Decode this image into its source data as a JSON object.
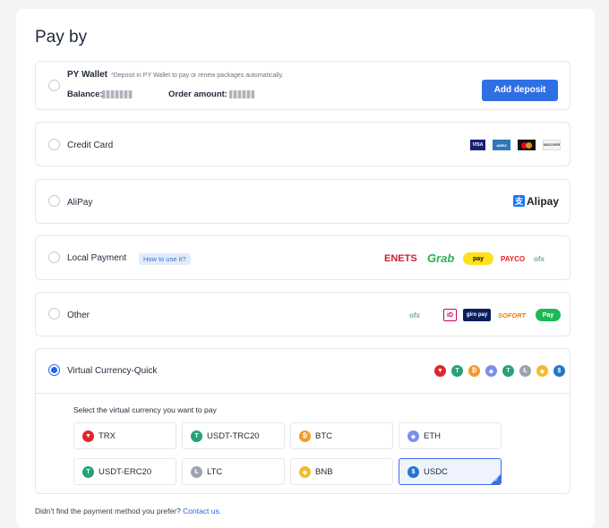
{
  "page": {
    "title": "Pay by"
  },
  "colors": {
    "accent": "#2f6fe4",
    "selected": "#2563eb"
  },
  "wallet": {
    "label": "PY Wallet",
    "note": "*Deposit in PY Wallet to pay or renew packages automatically.",
    "balance_label": "Balance:",
    "order_amount_label": "Order amount:",
    "add_deposit": "Add deposit"
  },
  "options": {
    "credit_card": {
      "label": "Credit Card",
      "logos": [
        "VISA",
        "AMEX",
        "mastercard",
        "DISCOVER"
      ]
    },
    "alipay": {
      "label": "AliPay",
      "logo_text": "Alipay"
    },
    "local": {
      "label": "Local Payment",
      "help": "How to use it?",
      "logos": [
        "ENETS",
        "Grab",
        "pay",
        "PAYCO",
        "ofx"
      ]
    },
    "other": {
      "label": "Other",
      "logos": [
        "ofx",
        "iD",
        "giro pay",
        "SOFORT",
        "Pay"
      ]
    },
    "virtual": {
      "label": "Virtual Currency-Quick"
    }
  },
  "virtual": {
    "hint": "Select the virtual currency you want to pay",
    "coins": [
      {
        "label": "TRX",
        "color": "#e0262c",
        "icon": "trx-icon"
      },
      {
        "label": "USDT-TRC20",
        "color": "#26a17b",
        "icon": "usdt-icon"
      },
      {
        "label": "BTC",
        "color": "#f59a2f",
        "icon": "btc-icon"
      },
      {
        "label": "ETH",
        "color": "#7b8ef0",
        "icon": "eth-icon"
      },
      {
        "label": "USDT-ERC20",
        "color": "#26a17b",
        "icon": "usdt-icon"
      },
      {
        "label": "LTC",
        "color": "#9ca3af",
        "icon": "ltc-icon"
      },
      {
        "label": "BNB",
        "color": "#f3ba2f",
        "icon": "bnb-icon"
      },
      {
        "label": "USDC",
        "color": "#2775ca",
        "icon": "usdc-icon",
        "selected": true
      }
    ]
  },
  "footer": {
    "text": "Didn't find the payment method you prefer?",
    "link": "Contact us."
  }
}
